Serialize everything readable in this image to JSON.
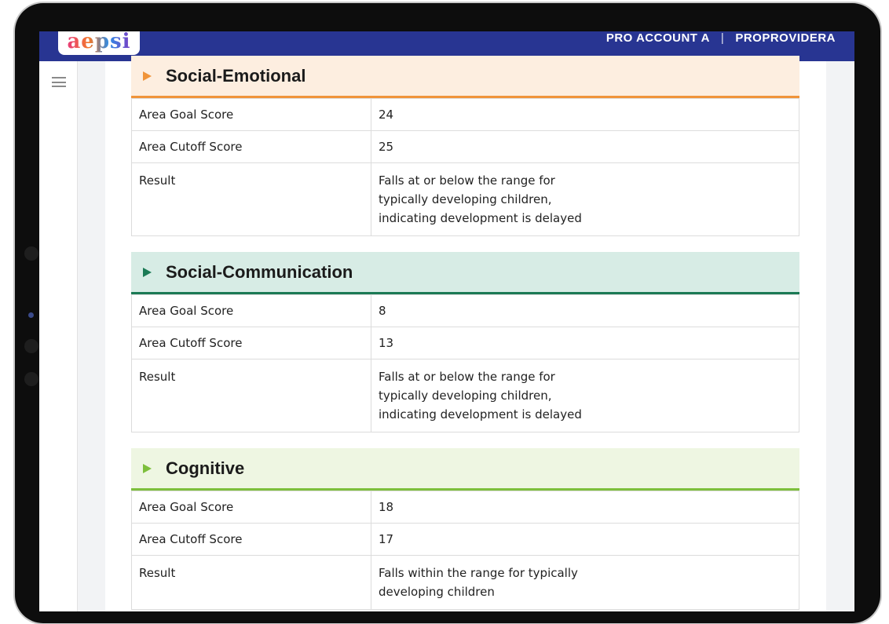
{
  "header": {
    "logo_text": "aepsi",
    "account_name": "PRO ACCOUNT A",
    "separator": "|",
    "provider_name": "PROPROVIDERA"
  },
  "nav": {
    "menu_icon": "hamburger-icon"
  },
  "sections": [
    {
      "title": "Social-Emotional",
      "accent": "#f0943a",
      "header_bg": "#fdeee0",
      "rows": [
        {
          "label": "Area Goal Score",
          "value": "24"
        },
        {
          "label": "Area Cutoff Score",
          "value": "25"
        },
        {
          "label": "Result",
          "value_lines": [
            "Falls at or below the range for",
            "typically developing children,",
            "indicating development is delayed"
          ]
        }
      ]
    },
    {
      "title": "Social-Communication",
      "accent": "#1b7a55",
      "header_bg": "#d7ece5",
      "rows": [
        {
          "label": "Area Goal Score",
          "value": "8"
        },
        {
          "label": "Area Cutoff Score",
          "value": "13"
        },
        {
          "label": "Result",
          "value_lines": [
            "Falls at or below the range for",
            "typically developing children,",
            "indicating development is delayed"
          ]
        }
      ]
    },
    {
      "title": "Cognitive",
      "accent": "#7dbf3c",
      "header_bg": "#eef6e2",
      "rows": [
        {
          "label": "Area Goal Score",
          "value": "18"
        },
        {
          "label": "Area Cutoff Score",
          "value": "17"
        },
        {
          "label": "Result",
          "value_lines": [
            "Falls within the range for typically",
            "developing children"
          ]
        }
      ]
    }
  ]
}
